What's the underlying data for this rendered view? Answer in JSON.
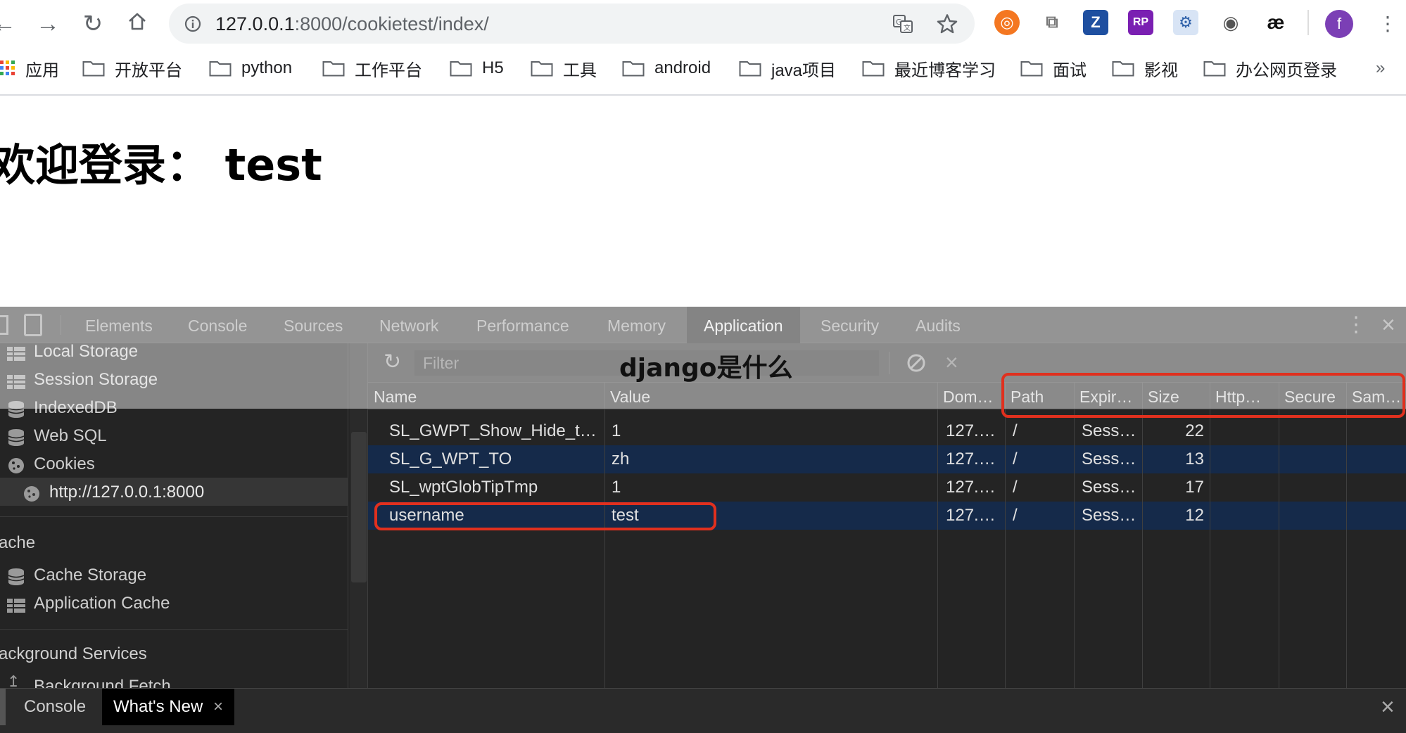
{
  "browser": {
    "url_host": "127.0.0.1",
    "url_rest": ":8000/cookietest/index/",
    "avatar_letter": "f",
    "bookmarks": [
      {
        "label": "应用"
      },
      {
        "label": "开放平台"
      },
      {
        "label": "python"
      },
      {
        "label": "工作平台"
      },
      {
        "label": "H5"
      },
      {
        "label": "工具"
      },
      {
        "label": "android"
      },
      {
        "label": "java项目"
      },
      {
        "label": "最近博客学习"
      },
      {
        "label": "面试"
      },
      {
        "label": "影视"
      },
      {
        "label": "办公网页登录"
      }
    ],
    "more": "»"
  },
  "page": {
    "heading": "欢迎登录：  test"
  },
  "devtools": {
    "tabs": [
      "Elements",
      "Console",
      "Sources",
      "Network",
      "Performance",
      "Memory",
      "Application",
      "Security",
      "Audits"
    ],
    "active_tab": "Application",
    "sidebar": {
      "local_storage": "Local Storage",
      "session_storage": "Session Storage",
      "indexeddb": "IndexedDB",
      "web_sql": "Web SQL",
      "cookies": "Cookies",
      "cookie_origin": "http://127.0.0.1:8000",
      "cache_section": "ache",
      "cache_storage": "Cache Storage",
      "application_cache": "Application Cache",
      "bg_section": "ackground Services",
      "bg_fetch": "Background Fetch"
    },
    "filter_placeholder": "Filter",
    "columns": [
      "Name",
      "Value",
      "Dom…",
      "Path",
      "Expir…",
      "Size",
      "Http…",
      "Secure",
      "Sam…"
    ],
    "rows": [
      {
        "name": "SL_GWPT_Show_Hide_t…",
        "value": "1",
        "domain": "127.…",
        "path": "/",
        "expires": "Sess…",
        "size": "22"
      },
      {
        "name": "SL_G_WPT_TO",
        "value": "zh",
        "domain": "127.…",
        "path": "/",
        "expires": "Sess…",
        "size": "13"
      },
      {
        "name": "SL_wptGlobTipTmp",
        "value": "1",
        "domain": "127.…",
        "path": "/",
        "expires": "Sess…",
        "size": "17"
      },
      {
        "name": "username",
        "value": "test",
        "domain": "127.…",
        "path": "/",
        "expires": "Sess…",
        "size": "12"
      }
    ],
    "drawer_tabs": [
      "Console",
      "What's New"
    ],
    "close_glyph": "×"
  },
  "watermark": "django是什么",
  "colors": {
    "highlight": "#e0301e",
    "selected_row": "#152a4a",
    "devtools_bg": "#242424"
  }
}
